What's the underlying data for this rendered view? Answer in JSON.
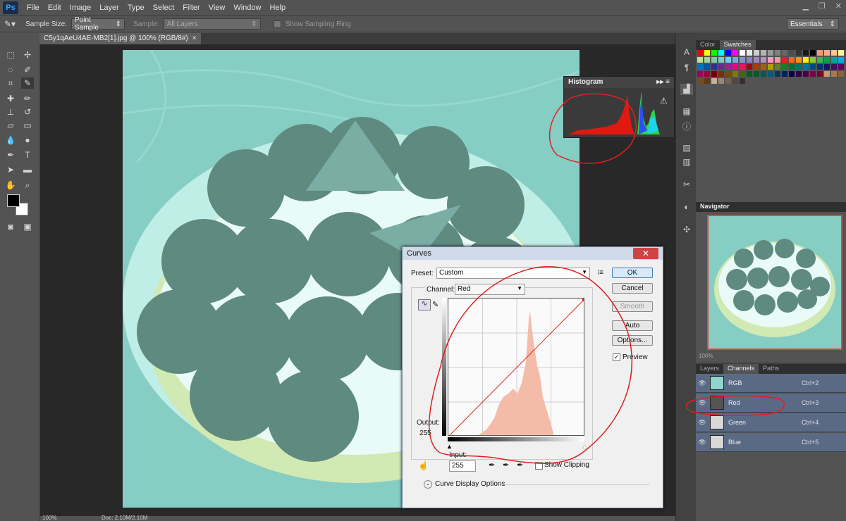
{
  "app": {
    "logo": "Ps"
  },
  "menu": [
    "File",
    "Edit",
    "Image",
    "Layer",
    "Type",
    "Select",
    "Filter",
    "View",
    "Window",
    "Help"
  ],
  "options_bar": {
    "sample_size_label": "Sample Size:",
    "sample_size_value": "Point Sample",
    "sample_label": "Sample:",
    "sample_value": "All Layers",
    "show_ring_label": "Show Sampling Ring",
    "workspace": "Essentials"
  },
  "document": {
    "tab_title": "C5y1qAeU4AE-MB2[1].jpg @ 100% (RGB/8#)",
    "close": "×"
  },
  "status": {
    "zoom": "100%",
    "doc": "Doc: 2.10M/2.10M"
  },
  "histogram": {
    "title": "Histogram",
    "warning_icon": "warning-icon"
  },
  "right_panels": {
    "tabs_top": [
      "Color",
      "Swatches"
    ],
    "navigator_title": "Navigator",
    "navigator_zoom": "100%",
    "tabs_layers": [
      "Layers",
      "Channels",
      "Paths"
    ],
    "channels": [
      {
        "name": "RGB",
        "key": "Ctrl+2"
      },
      {
        "name": "Red",
        "key": "Ctrl+3"
      },
      {
        "name": "Green",
        "key": "Ctrl+4"
      },
      {
        "name": "Blue",
        "key": "Ctrl+5"
      }
    ]
  },
  "curves": {
    "title": "Curves",
    "close": "✕",
    "preset_label": "Preset:",
    "preset_value": "Custom",
    "channel_label": "Channel:",
    "channel_value": "Red",
    "output_label": "Output:",
    "output_value": "255",
    "input_label": "Input:",
    "input_value": "255",
    "show_clipping_label": "Show Clipping",
    "display_options_label": "Curve Display Options",
    "buttons": {
      "ok": "OK",
      "cancel": "Cancel",
      "smooth": "Smooth",
      "auto": "Auto",
      "options": "Options..."
    },
    "preview_label": "Preview",
    "preview_checked": true
  },
  "colors": {
    "accent_red": "#e02020",
    "photo_tint": "#8fd6cf",
    "histogram_fill": "#f4bca8"
  }
}
